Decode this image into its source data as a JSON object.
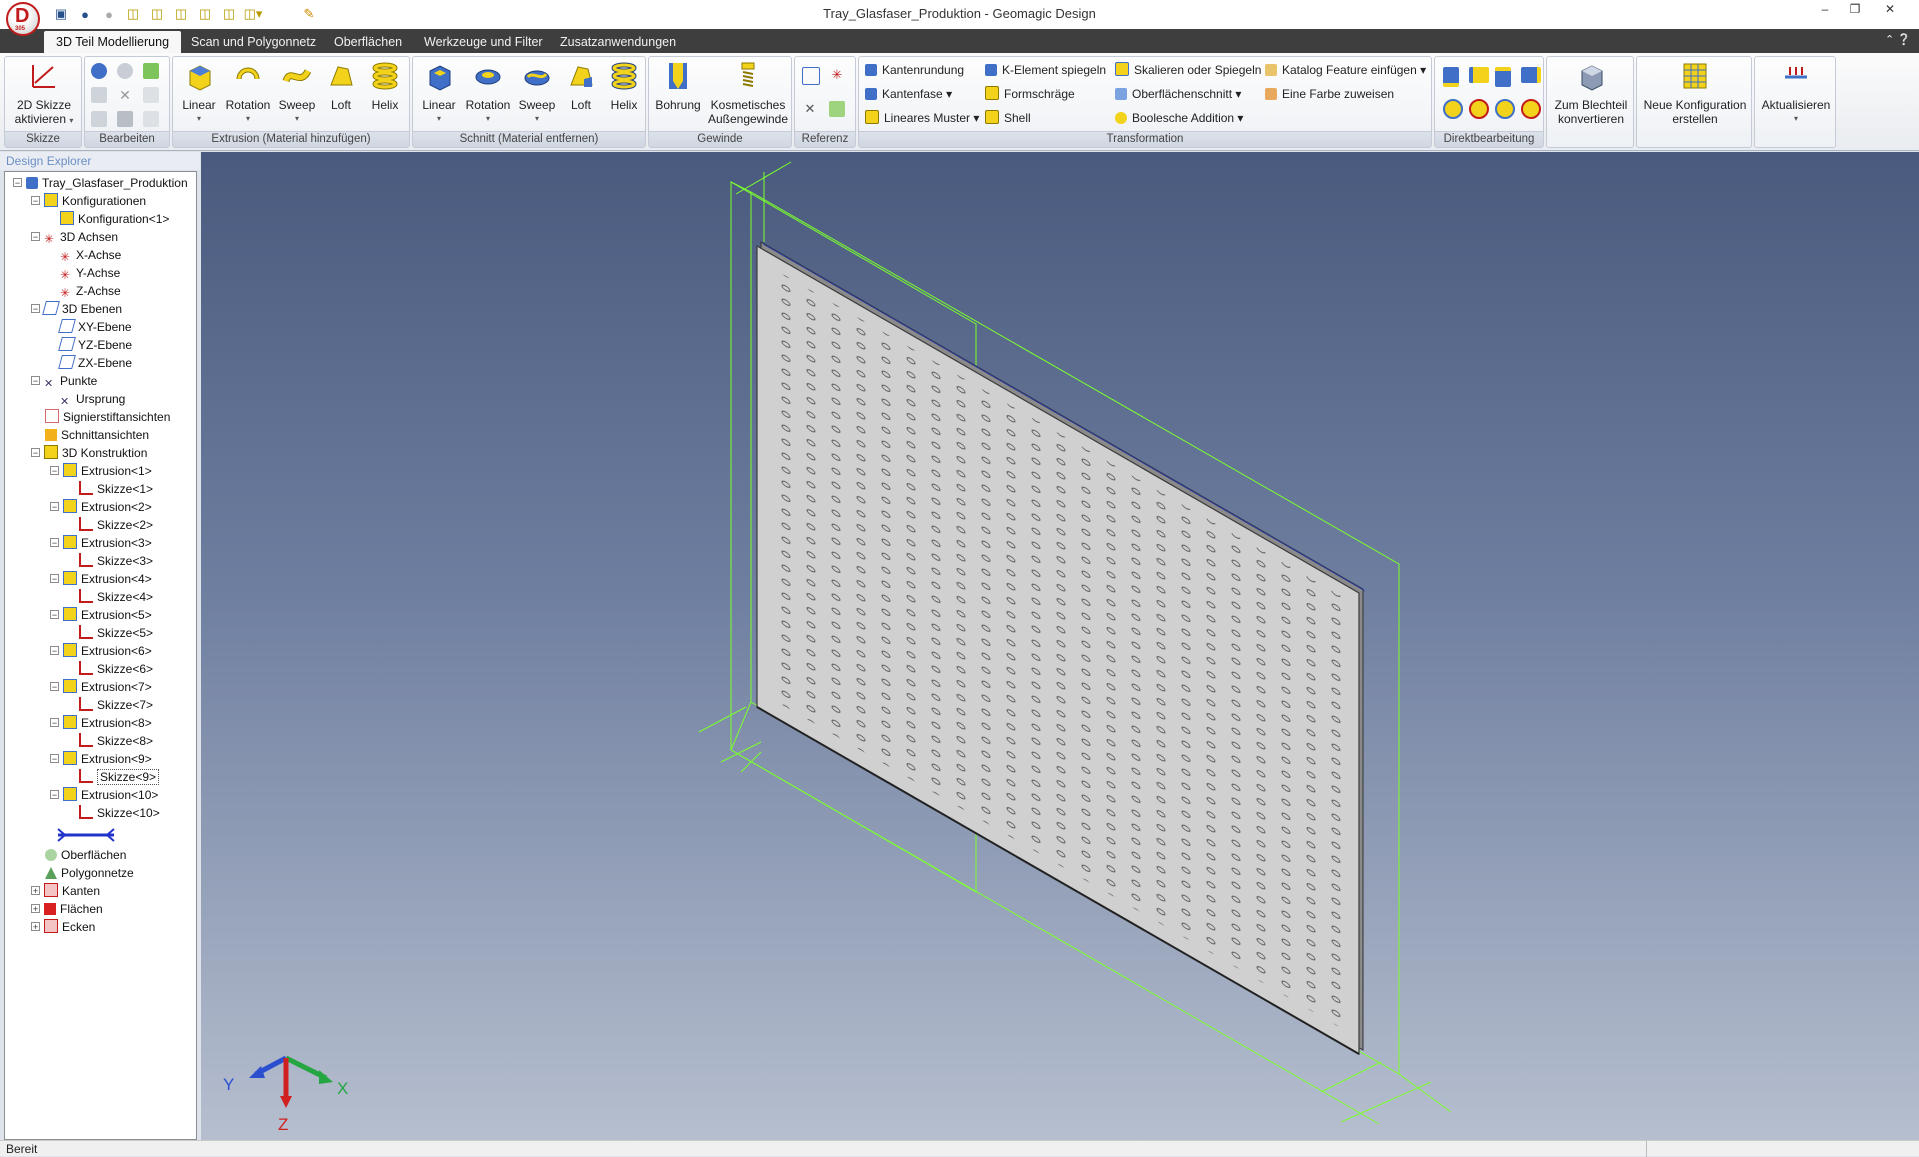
{
  "window": {
    "title": "Tray_Glasfaser_Produktion - Geomagic Design"
  },
  "tabs": [
    {
      "label": "3D Teil Modellierung",
      "active": true
    },
    {
      "label": "Scan und Polygonnetz"
    },
    {
      "label": "Oberflächen"
    },
    {
      "label": "Werkzeuge und Filter"
    },
    {
      "label": "Zusatzanwendungen"
    }
  ],
  "ribbon": {
    "skizze": {
      "title": "Skizze",
      "btn_line1": "2D Skizze",
      "btn_line2": "aktivieren"
    },
    "bearbeiten": {
      "title": "Bearbeiten"
    },
    "extrusion": {
      "title": "Extrusion (Material hinzufügen)",
      "buttons": [
        "Linear",
        "Rotation",
        "Sweep",
        "Loft",
        "Helix"
      ]
    },
    "schnitt": {
      "title": "Schnitt (Material entfernen)",
      "buttons": [
        "Linear",
        "Rotation",
        "Sweep",
        "Loft",
        "Helix"
      ]
    },
    "gewinde": {
      "title": "Gewinde",
      "bohrung": "Bohrung",
      "kosm_line1": "Kosmetisches",
      "kosm_line2": "Außengewinde"
    },
    "referenz": {
      "title": "Referenz"
    },
    "transformation": {
      "title": "Transformation",
      "items": [
        "Kantenrundung",
        "Kantenfase",
        "Lineares Muster",
        "K-Element spiegeln",
        "Formschräge",
        "Shell",
        "Skalieren oder Spiegeln",
        "Oberflächenschnitt",
        "Boolesche Addition",
        "Katalog Feature einfügen",
        "Eine Farbe zuweisen"
      ]
    },
    "direkt": {
      "title": "Direktbearbeitung"
    },
    "blech": {
      "line1": "Zum Blechteil",
      "line2": "konvertieren"
    },
    "konfig": {
      "line1": "Neue Konfiguration",
      "line2": "erstellen"
    },
    "aktualisieren": {
      "label": "Aktualisieren"
    }
  },
  "explorer": {
    "title": "Design Explorer",
    "nodes": [
      "Tray_Glasfaser_Produktion",
      "Konfigurationen",
      "Konfiguration<1>",
      "3D Achsen",
      "X-Achse",
      "Y-Achse",
      "Z-Achse",
      "3D Ebenen",
      "XY-Ebene",
      "YZ-Ebene",
      "ZX-Ebene",
      "Punkte",
      "Ursprung",
      "Signierstiftansichten",
      "Schnittansichten",
      "3D Konstruktion",
      "Extrusion<1>",
      "Skizze<1>",
      "Extrusion<2>",
      "Skizze<2>",
      "Extrusion<3>",
      "Skizze<3>",
      "Extrusion<4>",
      "Skizze<4>",
      "Extrusion<5>",
      "Skizze<5>",
      "Extrusion<6>",
      "Skizze<6>",
      "Extrusion<7>",
      "Skizze<7>",
      "Extrusion<8>",
      "Skizze<8>",
      "Extrusion<9>",
      "Skizze<9>",
      "Extrusion<10>",
      "Skizze<10>",
      "Oberflächen",
      "Polygonnetze",
      "Kanten",
      "Flächen",
      "Ecken"
    ]
  },
  "viewport": {
    "axis_labels": {
      "x": "X",
      "y": "Y",
      "z": "Z"
    }
  },
  "status": {
    "text": "Bereit"
  },
  "colors": {
    "selection_green": "#7cff2e",
    "viewport_top": "#4a5a7e",
    "viewport_bottom": "#b6bfcf",
    "part_face": "#d0d0d0"
  }
}
